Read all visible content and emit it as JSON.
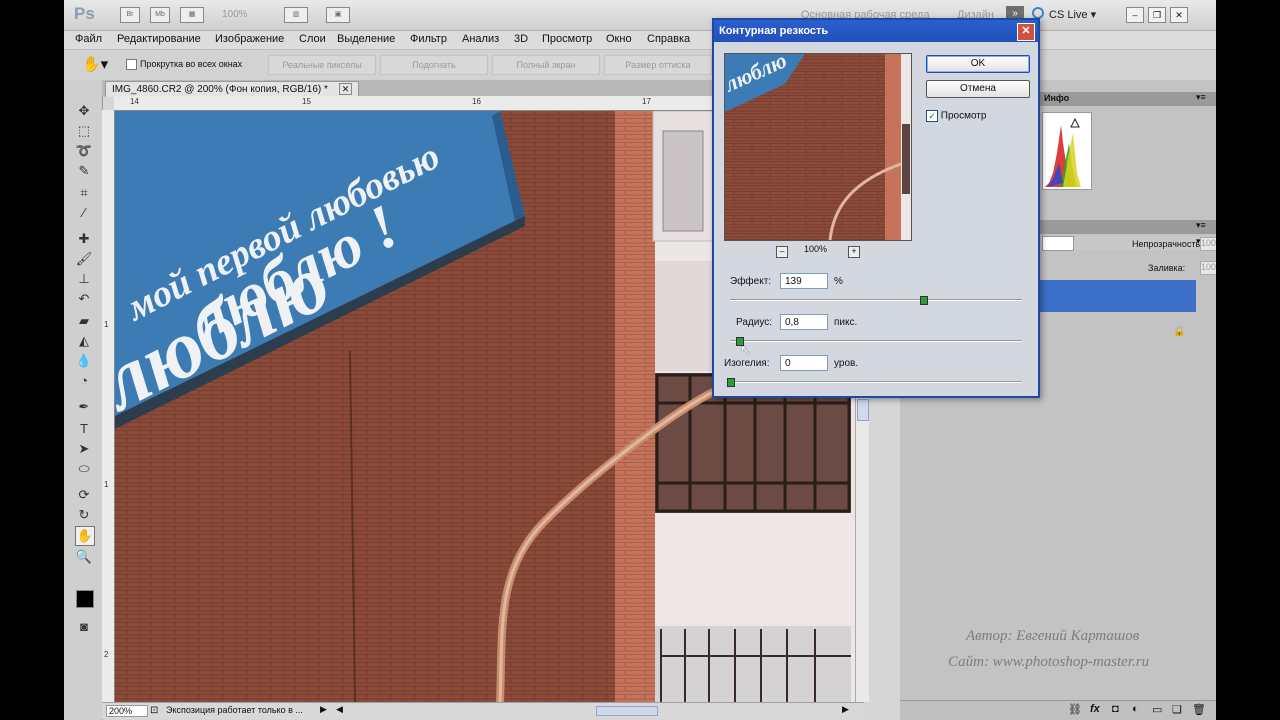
{
  "app": {
    "logo": "Ps",
    "zoom_display": "100%",
    "workspace_label": "Основная рабочая среда",
    "workspace_label2": "Дизайн",
    "workspace_more": "»",
    "cslive_label": "CS Live ▾",
    "window_buttons": [
      "–",
      "❐",
      "✕"
    ]
  },
  "menu": [
    "Файл",
    "Редактирование",
    "Изображение",
    "Слои",
    "Выделение",
    "Фильтр",
    "Анализ",
    "3D",
    "Просмотр",
    "Окно",
    "Справка"
  ],
  "options_bar": {
    "scroll_all_label": "Прокрутка во всех окнах",
    "buttons": [
      "Реальные пикселы",
      "Подогнать",
      "Полный экран",
      "Размер оттиска"
    ]
  },
  "document": {
    "tab_title": "IMG_4860.CR2 @ 200% (Фон копия, RGB/16) *",
    "tab_close": "✕",
    "ruler_top_numbers": [
      "14",
      "15",
      "16",
      "17"
    ],
    "ruler_left_numbers": [
      "1",
      "1",
      "2"
    ],
    "canvas_text_top": "мой первой любовью",
    "canvas_text_main": "люблю !",
    "canvas_text_second": "люблю",
    "status_zoom": "200%",
    "status_text": "Экспозиция работает только в ..."
  },
  "panels": {
    "histogram_tab": "Инфо",
    "opacity_label": "Непрозрачность:",
    "opacity_value": "100%",
    "fill_label": "Заливка:",
    "fill_value": "100%",
    "bottom_icons": [
      "link-icon",
      "fx-icon",
      "mask-icon",
      "adjustment-icon",
      "folder-icon",
      "new-layer-icon",
      "trash-icon"
    ]
  },
  "dialog": {
    "title": "Контурная резкость",
    "close": "✕",
    "ok_label": "OK",
    "cancel_label": "Отмена",
    "preview_label": "Просмотр",
    "preview_checked": true,
    "preview_zoom": "100%",
    "zoom_out": "–",
    "zoom_in": "+",
    "effect_label": "Эффект:",
    "effect_value": "139",
    "effect_unit": "%",
    "effect_slider_fraction": 0.66,
    "radius_label": "Радиус:",
    "radius_value": "0,8",
    "radius_unit": "пикс.",
    "radius_slider_fraction": 0.03,
    "threshold_label": "Изогелия:",
    "threshold_value": "0",
    "threshold_unit": "уров.",
    "threshold_slider_fraction": 0.0
  },
  "watermark": {
    "line1": "Автор: Евгений Карташов",
    "line2": "Сайт: www.photoshop-master.ru"
  },
  "colors": {
    "brick": "#8a4a38",
    "sign_blue": "#3c7bb4",
    "dialog_title_blue": "#2350b8",
    "layer_selected": "#3c6fc8"
  }
}
